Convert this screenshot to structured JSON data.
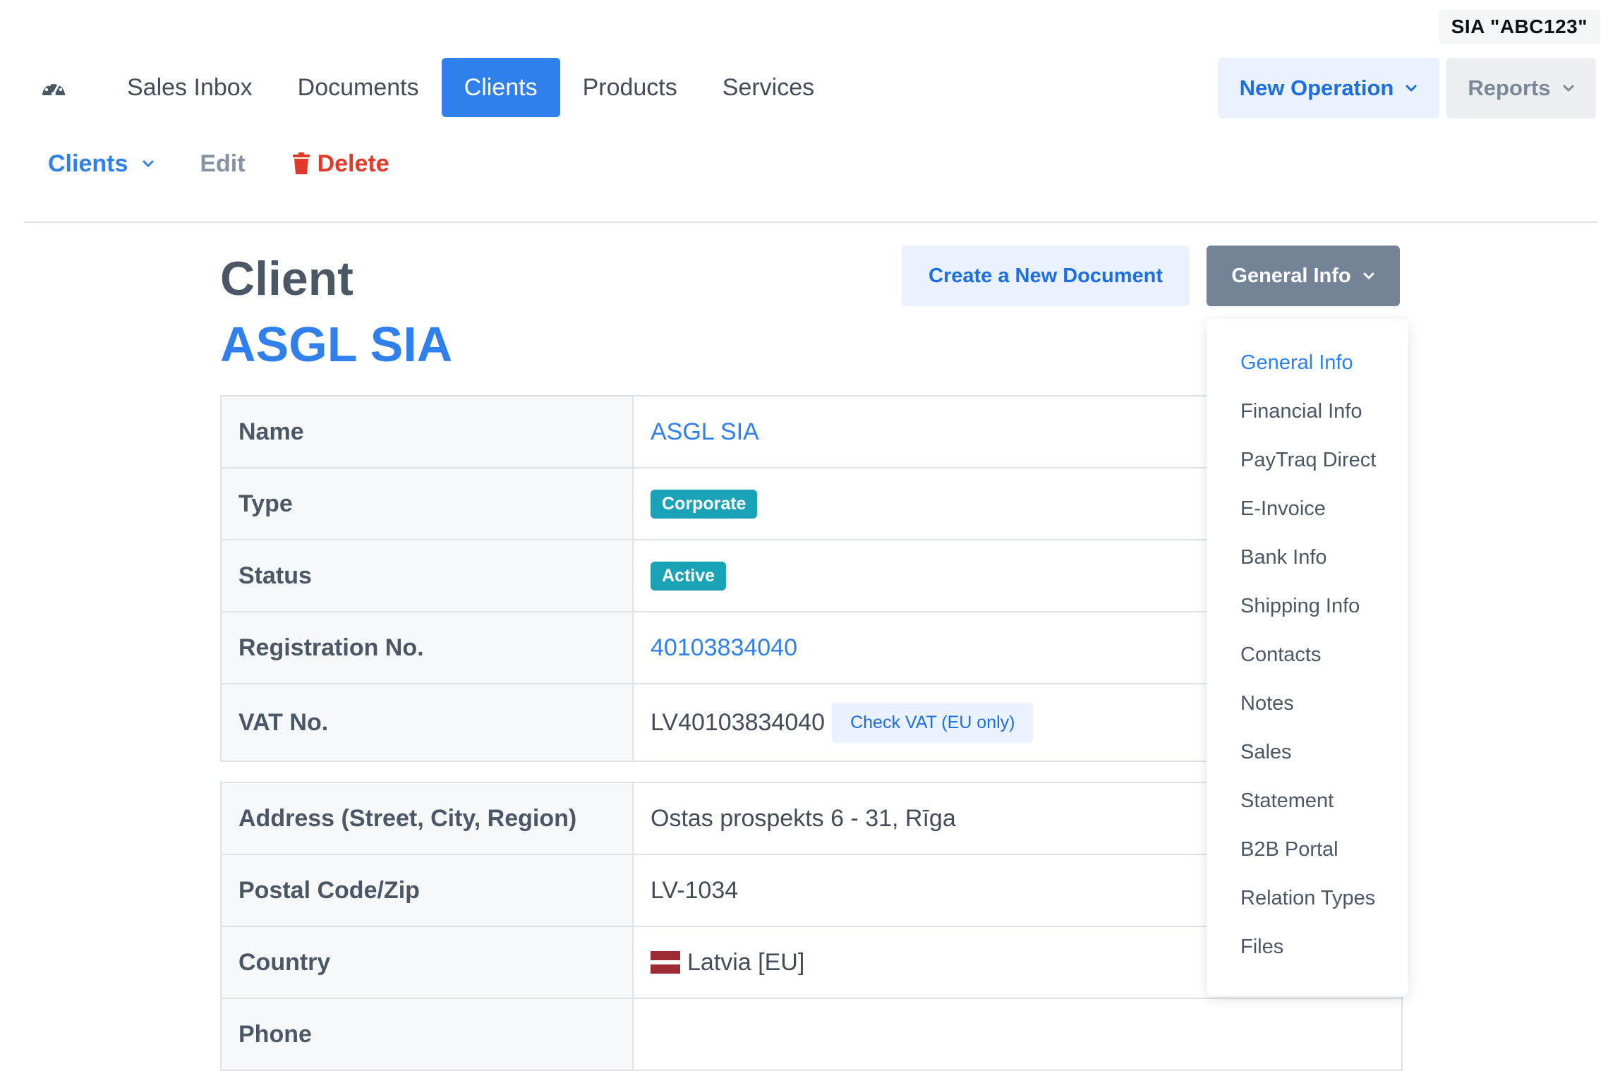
{
  "company": "SIA \"ABC123\"",
  "nav": {
    "items": [
      "Sales Inbox",
      "Documents",
      "Clients",
      "Products",
      "Services"
    ],
    "active": "Clients",
    "new_operation": "New Operation",
    "reports": "Reports"
  },
  "subnav": {
    "clients": "Clients",
    "edit": "Edit",
    "delete": "Delete"
  },
  "page": {
    "heading": "Client",
    "client_name": "ASGL SIA",
    "create_document": "Create a New Document",
    "general_info": "General Info"
  },
  "table1": {
    "rows": [
      {
        "label": "Name",
        "value": "ASGL SIA"
      },
      {
        "label": "Type",
        "value": "Corporate"
      },
      {
        "label": "Status",
        "value": "Active"
      },
      {
        "label": "Registration No.",
        "value": "40103834040"
      },
      {
        "label": "VAT No.",
        "value": "LV40103834040",
        "action": "Check VAT (EU only)"
      }
    ]
  },
  "table2": {
    "rows": [
      {
        "label": "Address (Street, City, Region)",
        "value": "Ostas prospekts 6 - 31, Rīga"
      },
      {
        "label": "Postal Code/Zip",
        "value": "LV-1034"
      },
      {
        "label": "Country",
        "value": "Latvia [EU]"
      },
      {
        "label": "Phone",
        "value": ""
      }
    ]
  },
  "dropdown": {
    "items": [
      "General Info",
      "Financial Info",
      "PayTraq Direct",
      "E-Invoice",
      "Bank Info",
      "Shipping Info",
      "Contacts",
      "Notes",
      "Sales",
      "Statement",
      "B2B Portal",
      "Relation Types",
      "Files"
    ],
    "active": "General Info"
  },
  "icons": {
    "dashboard": "speedometer-icon",
    "delete": "trash-icon",
    "chevron": "chevron-down-icon"
  },
  "colors": {
    "primary": "#2f80ed",
    "danger": "#e03b2a",
    "badge": "#1aa3b7",
    "secondary_button": "#758396"
  }
}
